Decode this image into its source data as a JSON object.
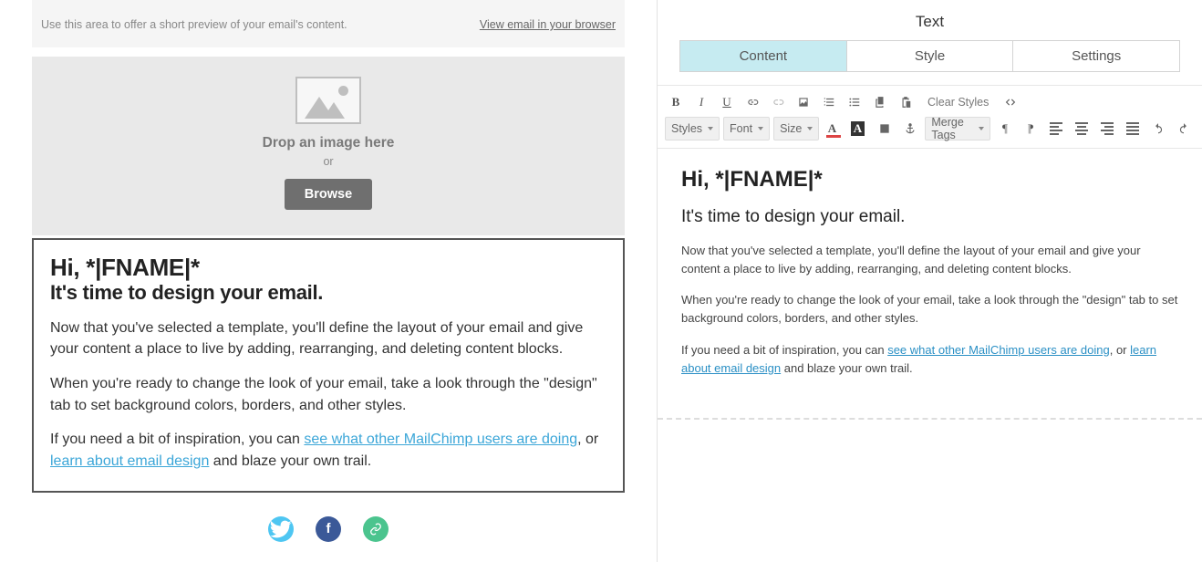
{
  "preview": {
    "preheader_text": "Use this area to offer a short preview of your email's content.",
    "view_browser_link": "View email in your browser",
    "drop_label": "Drop an image here",
    "or_label": "or",
    "browse_label": "Browse",
    "heading": "Hi, *|FNAME|*",
    "subheading": "It's time to design your email.",
    "para1": "Now that you've selected a template, you'll define the layout of your email and give your content a place to live by adding, rearranging, and deleting content blocks.",
    "para2": "When you're ready to change the look of your email, take a look through the \"design\" tab to set background colors, borders, and other styles.",
    "para3a": "If you need a bit of inspiration, you can ",
    "link1": "see what other MailChimp users are doing",
    "para3b": ", or ",
    "link2": "learn about email design",
    "para3c": " and blaze your own trail."
  },
  "panel": {
    "title": "Text",
    "tabs": {
      "content": "Content",
      "style": "Style",
      "settings": "Settings"
    }
  },
  "toolbar": {
    "bold": "B",
    "italic": "I",
    "underline": "U",
    "clear_styles": "Clear Styles",
    "styles_dd": "Styles",
    "font_dd": "Font",
    "size_dd": "Size",
    "merge_tags": "Merge Tags",
    "textcolor": "A",
    "bgcolor": "A"
  },
  "editor": {
    "heading": "Hi, *|FNAME|*",
    "subheading": "It's time to design your email.",
    "para1": "Now that you've selected a template, you'll define the layout of your email and give your content a place to live by adding, rearranging, and deleting content blocks.",
    "para2": "When you're ready to change the look of your email, take a look through the \"design\" tab to set background colors, borders, and other styles.",
    "para3a": "If you need a bit of inspiration, you can ",
    "link1": "see what other MailChimp users are doing",
    "para3b": ", or ",
    "link2": "learn about email design",
    "para3c": " and blaze your own trail."
  }
}
